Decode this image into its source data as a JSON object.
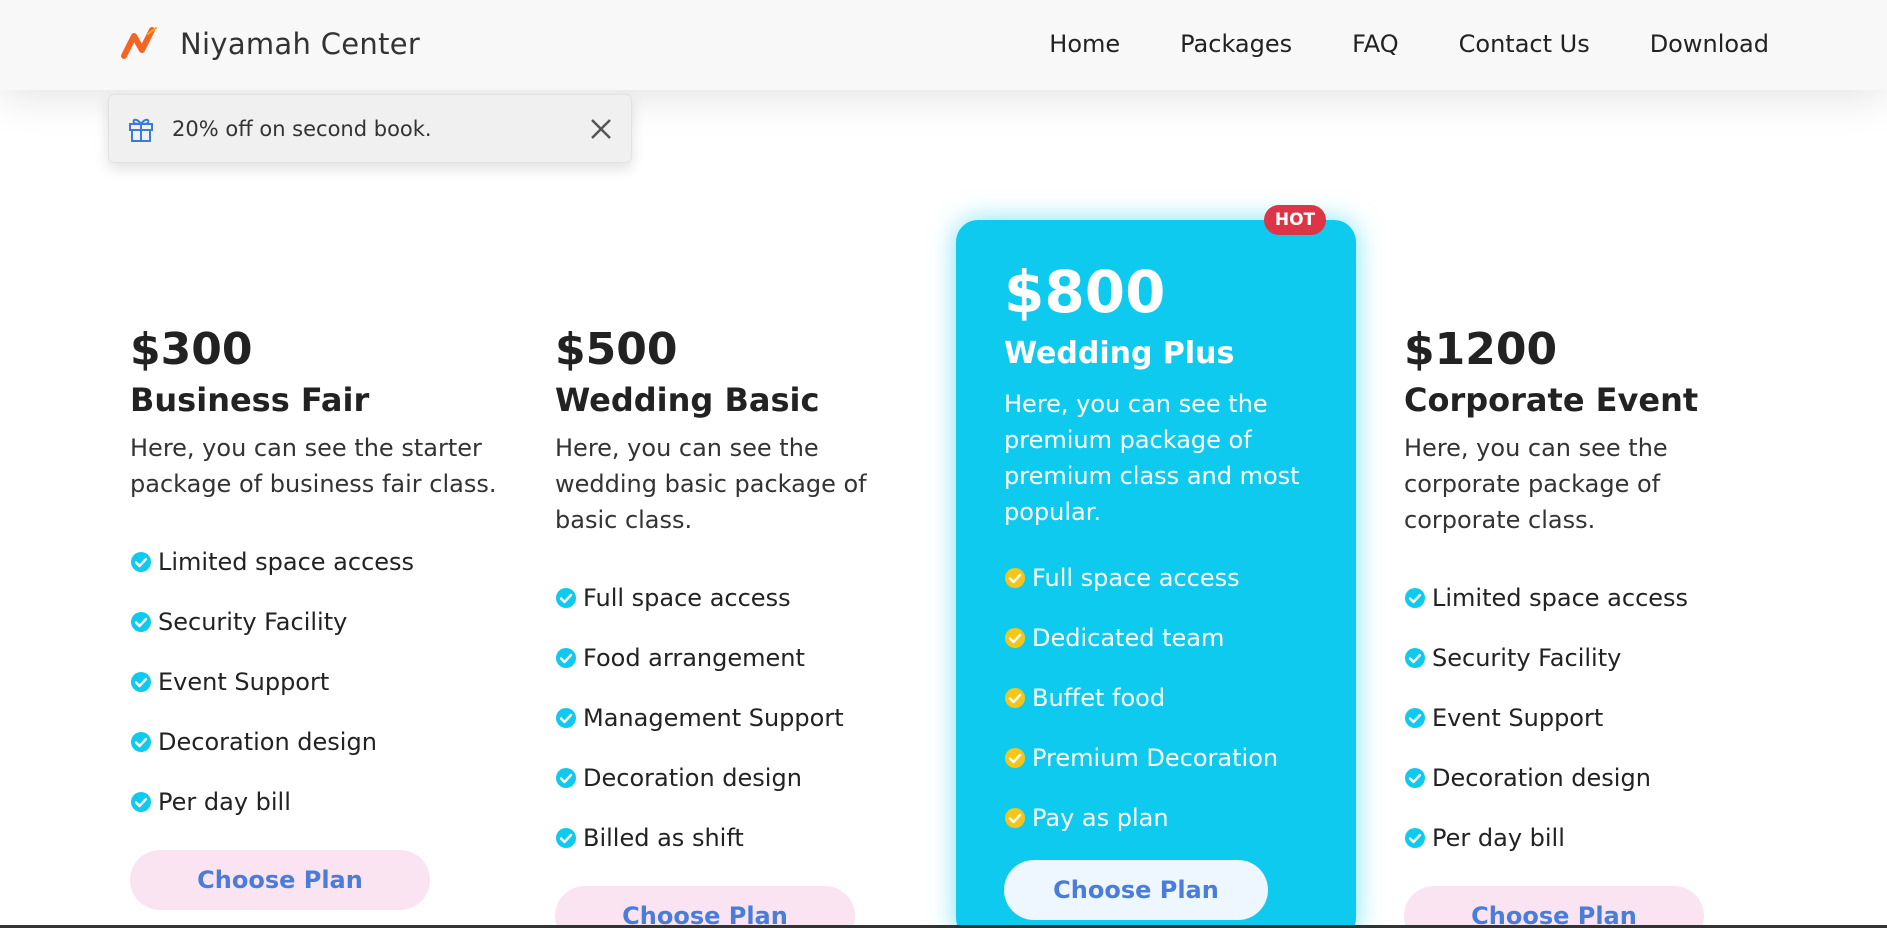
{
  "navbar": {
    "brand": "Niyamah Center",
    "links": [
      "Home",
      "Packages",
      "FAQ",
      "Contact Us",
      "Download"
    ]
  },
  "toast": {
    "message": "20% off on second book.",
    "icon": "gift-icon",
    "close_icon": "close-icon"
  },
  "plans": [
    {
      "price": "$300",
      "name": "Business Fair",
      "description": "Here, you can see the starter package of business fair class.",
      "features": [
        "Limited space access",
        "Security Facility",
        "Event Support",
        "Decoration design",
        "Per day bill"
      ],
      "button": "Choose Plan"
    },
    {
      "price": "$500",
      "name": "Wedding Basic",
      "description": "Here, you can see the wedding basic package of basic class.",
      "features": [
        "Full space access",
        "Food arrangement",
        "Management Support",
        "Decoration design",
        "Billed as shift"
      ],
      "button": "Choose Plan"
    },
    {
      "price": "$800",
      "name": "Wedding Plus",
      "description": "Here, you can see the premium package of premium class and most popular.",
      "features": [
        "Full space access",
        "Dedicated team",
        "Buffet food",
        "Premium Decoration",
        "Pay as plan"
      ],
      "button": "Choose Plan",
      "badge": "HOT"
    },
    {
      "price": "$1200",
      "name": "Corporate Event",
      "description": "Here, you can see the corporate package of corporate class.",
      "features": [
        "Limited space access",
        "Security Facility",
        "Event Support",
        "Decoration design",
        "Per day bill"
      ],
      "button": "Choose Plan"
    }
  ],
  "colors": {
    "featured_bg": "#0fcaef",
    "check_default": "#0fcaef",
    "check_featured": "#f5c518",
    "hot_badge": "#dc3545",
    "button_text": "#4a7dd9",
    "button_bg": "#fbe4f1",
    "logo_orange": "#f26522"
  },
  "icons": {
    "check": "check-circle-icon",
    "logo": "brand-logo-icon"
  }
}
